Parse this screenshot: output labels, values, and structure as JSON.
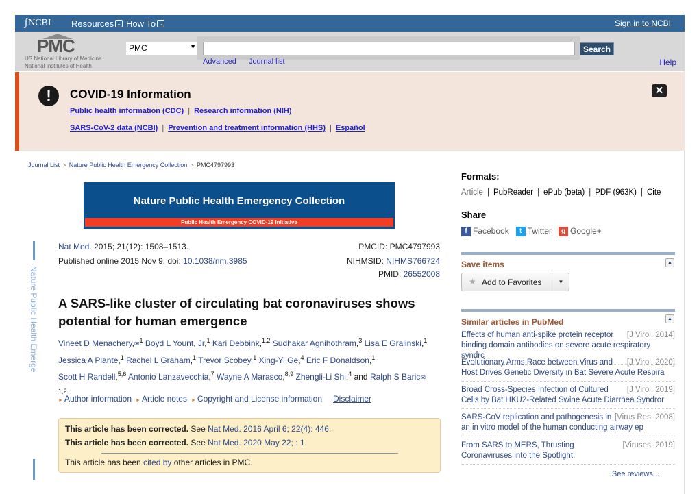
{
  "ncbi_bar": {
    "logo": "NCBI",
    "menus": [
      "Resources",
      "How To"
    ],
    "sign_in": "Sign in to NCBI"
  },
  "header": {
    "logo": "PMC",
    "org_line1": "US National Library of Medicine",
    "org_line2": "National Institutes of Health",
    "database_selected": "PMC",
    "search_value": "",
    "search_button": "Search",
    "links": [
      "Advanced",
      "Journal list"
    ],
    "help": "Help"
  },
  "covid": {
    "title": "COVID-19 Information",
    "row1": [
      "Public health information (CDC)",
      "Research information (NIH)"
    ],
    "row2": [
      "SARS-CoV-2 data (NCBI)",
      "Prevention and treatment information (HHS)",
      "Español"
    ],
    "separator": "|"
  },
  "breadcrumb": [
    "Journal List",
    "Nature Public Health Emergency Collection",
    "PMC4797993"
  ],
  "collection_banner": {
    "title": "Nature Public Health Emergency Collection",
    "strip": "Public Health Emergency COVID-19 Initiative"
  },
  "side_label": "Nature Public Health Emerge",
  "citation": {
    "journal": "Nat Med.",
    "details": " 2015; 21(12): 1508–1513.",
    "published": "Published online 2015 Nov 9. doi: ",
    "doi": "10.1038/nm.3985",
    "pmcid_label": "PMCID: ",
    "pmcid": "PMC4797993",
    "nihmsid_label": "NIHMSID: ",
    "nihmsid": "NIHMS766724",
    "pmid_label": "PMID: ",
    "pmid": "26552008"
  },
  "article": {
    "title": "A SARS-like cluster of circulating bat coronaviruses shows potential for human emergence",
    "authors": [
      {
        "name": "Vineet D Menachery",
        "sup": "1",
        "mail": true
      },
      {
        "name": "Boyd L Yount, Jr",
        "sup": "1"
      },
      {
        "name": "Kari Debbink",
        "sup": "1,2"
      },
      {
        "name": "Sudhakar Agnihothram",
        "sup": "3"
      },
      {
        "name": "Lisa E Gralinski",
        "sup": "1"
      },
      {
        "name": "Jessica A Plante",
        "sup": "1"
      },
      {
        "name": "Rachel L Graham",
        "sup": "1"
      },
      {
        "name": "Trevor Scobey",
        "sup": "1"
      },
      {
        "name": "Xing-Yi Ge",
        "sup": "4"
      },
      {
        "name": "Eric F Donaldson",
        "sup": "1"
      },
      {
        "name": "Scott H Randell",
        "sup": "5,6"
      },
      {
        "name": "Antonio Lanzavecchia",
        "sup": "7"
      },
      {
        "name": "Wayne A Marasco",
        "sup": "8,9"
      },
      {
        "name": "Zhengli-Li Shi",
        "sup": "4"
      },
      {
        "name": "Ralph S Baric",
        "sup": "1,2",
        "mail": true
      }
    ],
    "and_word": "and",
    "info_links": [
      "Author information",
      "Article notes",
      "Copyright and License information"
    ],
    "disclaimer": "Disclaimer"
  },
  "notice": {
    "bold": "This article has been corrected.",
    "see": " See ",
    "correction1": "Nat Med. 2016 April 6; 22(4): 446",
    "correction2": "Nat Med. 2020 May 22; : 1",
    "cited_pre": "This article has been ",
    "cited_link": "cited by",
    "cited_post": " other articles in PMC."
  },
  "formats": {
    "heading": "Formats:",
    "current": "Article",
    "links": [
      "PubReader",
      "ePub (beta)",
      "PDF (963K)",
      "Cite"
    ]
  },
  "share": {
    "heading": "Share",
    "items": [
      {
        "label": "Facebook",
        "icon": "facebook-icon",
        "color": "#3b5998"
      },
      {
        "label": "Twitter",
        "icon": "twitter-icon",
        "color": "#1da1f2"
      },
      {
        "label": "Google+",
        "icon": "google-plus-icon",
        "color": "#dd4b39"
      }
    ]
  },
  "save_items": {
    "heading": "Save items",
    "button": "Add to Favorites"
  },
  "similar": {
    "heading": "Similar articles in PubMed",
    "items": [
      {
        "title": "Effects of human anti-spike protein receptor binding domain antibodies on severe acute respiratory syndrc",
        "source": "[J Virol. 2014]"
      },
      {
        "title": "Evolutionary Arms Race between Virus and Host Drives Genetic Diversity in Bat Severe Acute Respira",
        "source": "[J Virol. 2020]"
      },
      {
        "title": "Broad Cross-Species Infection of Cultured Cells by Bat HKU2-Related Swine Acute Diarrhea Syndror",
        "source": "[J Virol. 2019]"
      },
      {
        "title": "SARS-CoV replication and pathogenesis in an in vitro model of the human conducting airway ep",
        "source": "[Virus Res. 2008]"
      },
      {
        "title": "From SARS to MERS, Thrusting Coronaviruses into the Spotlight.",
        "source": "[Viruses. 2019]"
      }
    ],
    "see_reviews": "See reviews..."
  },
  "colors": {
    "ncbi_bar": "#336699",
    "banner_accent": "#d7521a",
    "panel_heading": "#985735",
    "link": "#2f4a8a"
  }
}
